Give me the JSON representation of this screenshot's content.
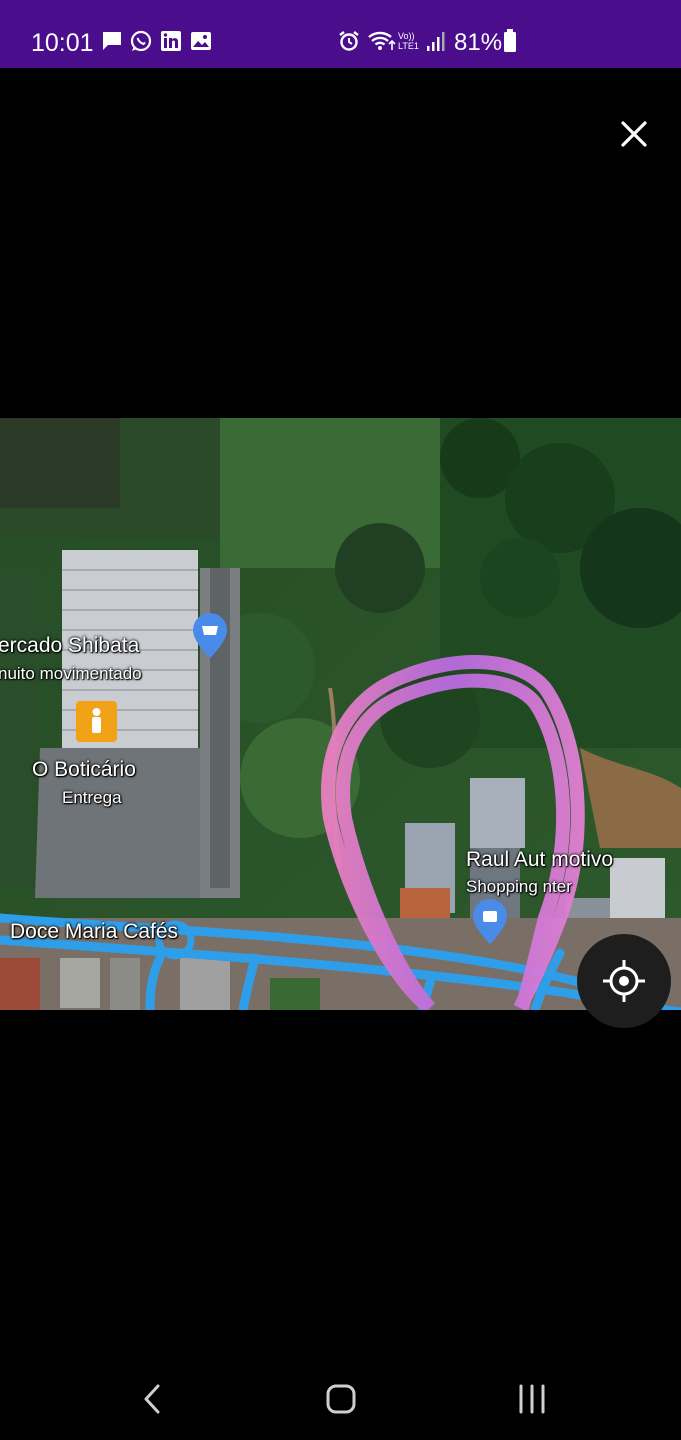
{
  "status_bar": {
    "time": "10:01",
    "left_icons": [
      "message-icon",
      "whatsapp-icon",
      "linkedin-icon",
      "gallery-icon"
    ],
    "right_icons": [
      "alarm-icon",
      "wifi-icon",
      "volte-icon",
      "signal-icon"
    ],
    "volte_text": "Vo)) LTE1",
    "battery_percent": "81%",
    "battery_level": 0.81,
    "background_color": "#4a0d8c"
  },
  "viewer": {
    "close_icon": "close-icon"
  },
  "map": {
    "labels": {
      "shibata": "ercado Shibata",
      "shibata_sub": "nuito movimentado",
      "boticario": "O Boticário",
      "boticario_sub": "Entrega",
      "raul": "Raul Aut   motivo",
      "raul_sub": "Shopping   nter",
      "doce_maria": "Doce Maria Cafés"
    },
    "annotation_color": "#c86de0",
    "road_color": "#2f9ee8"
  },
  "nav_bar": {
    "back_icon": "back-icon",
    "home_icon": "home-icon",
    "recents_icon": "recents-icon"
  }
}
